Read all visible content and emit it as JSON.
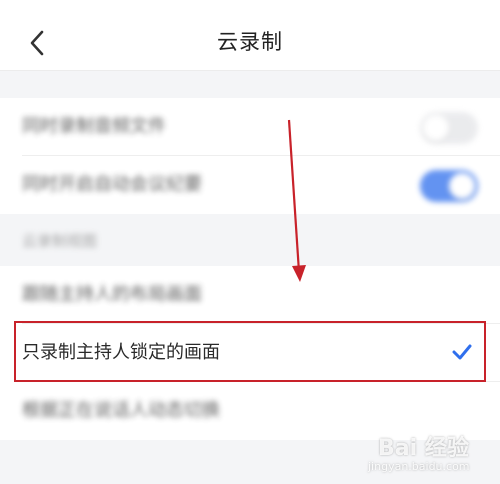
{
  "header": {
    "title": "云录制"
  },
  "settings": {
    "record_audio_label": "同时录制音频文件",
    "record_audio_on": false,
    "auto_minutes_label": "同时开启自动会议纪要",
    "auto_minutes_on": true
  },
  "view_section": {
    "label": "云录制视图",
    "options": [
      {
        "label": "跟随主持人的布局画面",
        "selected": false
      },
      {
        "label": "只录制主持人锁定的画面",
        "selected": true
      },
      {
        "label": "根据正在说话人动态切换",
        "selected": false
      }
    ]
  },
  "watermark": {
    "brand": "Bai 经验",
    "url": "jingyan.baidu.com"
  },
  "colors": {
    "accent": "#2f6fed",
    "highlight": "#c8222a",
    "arrow": "#c8222a"
  }
}
